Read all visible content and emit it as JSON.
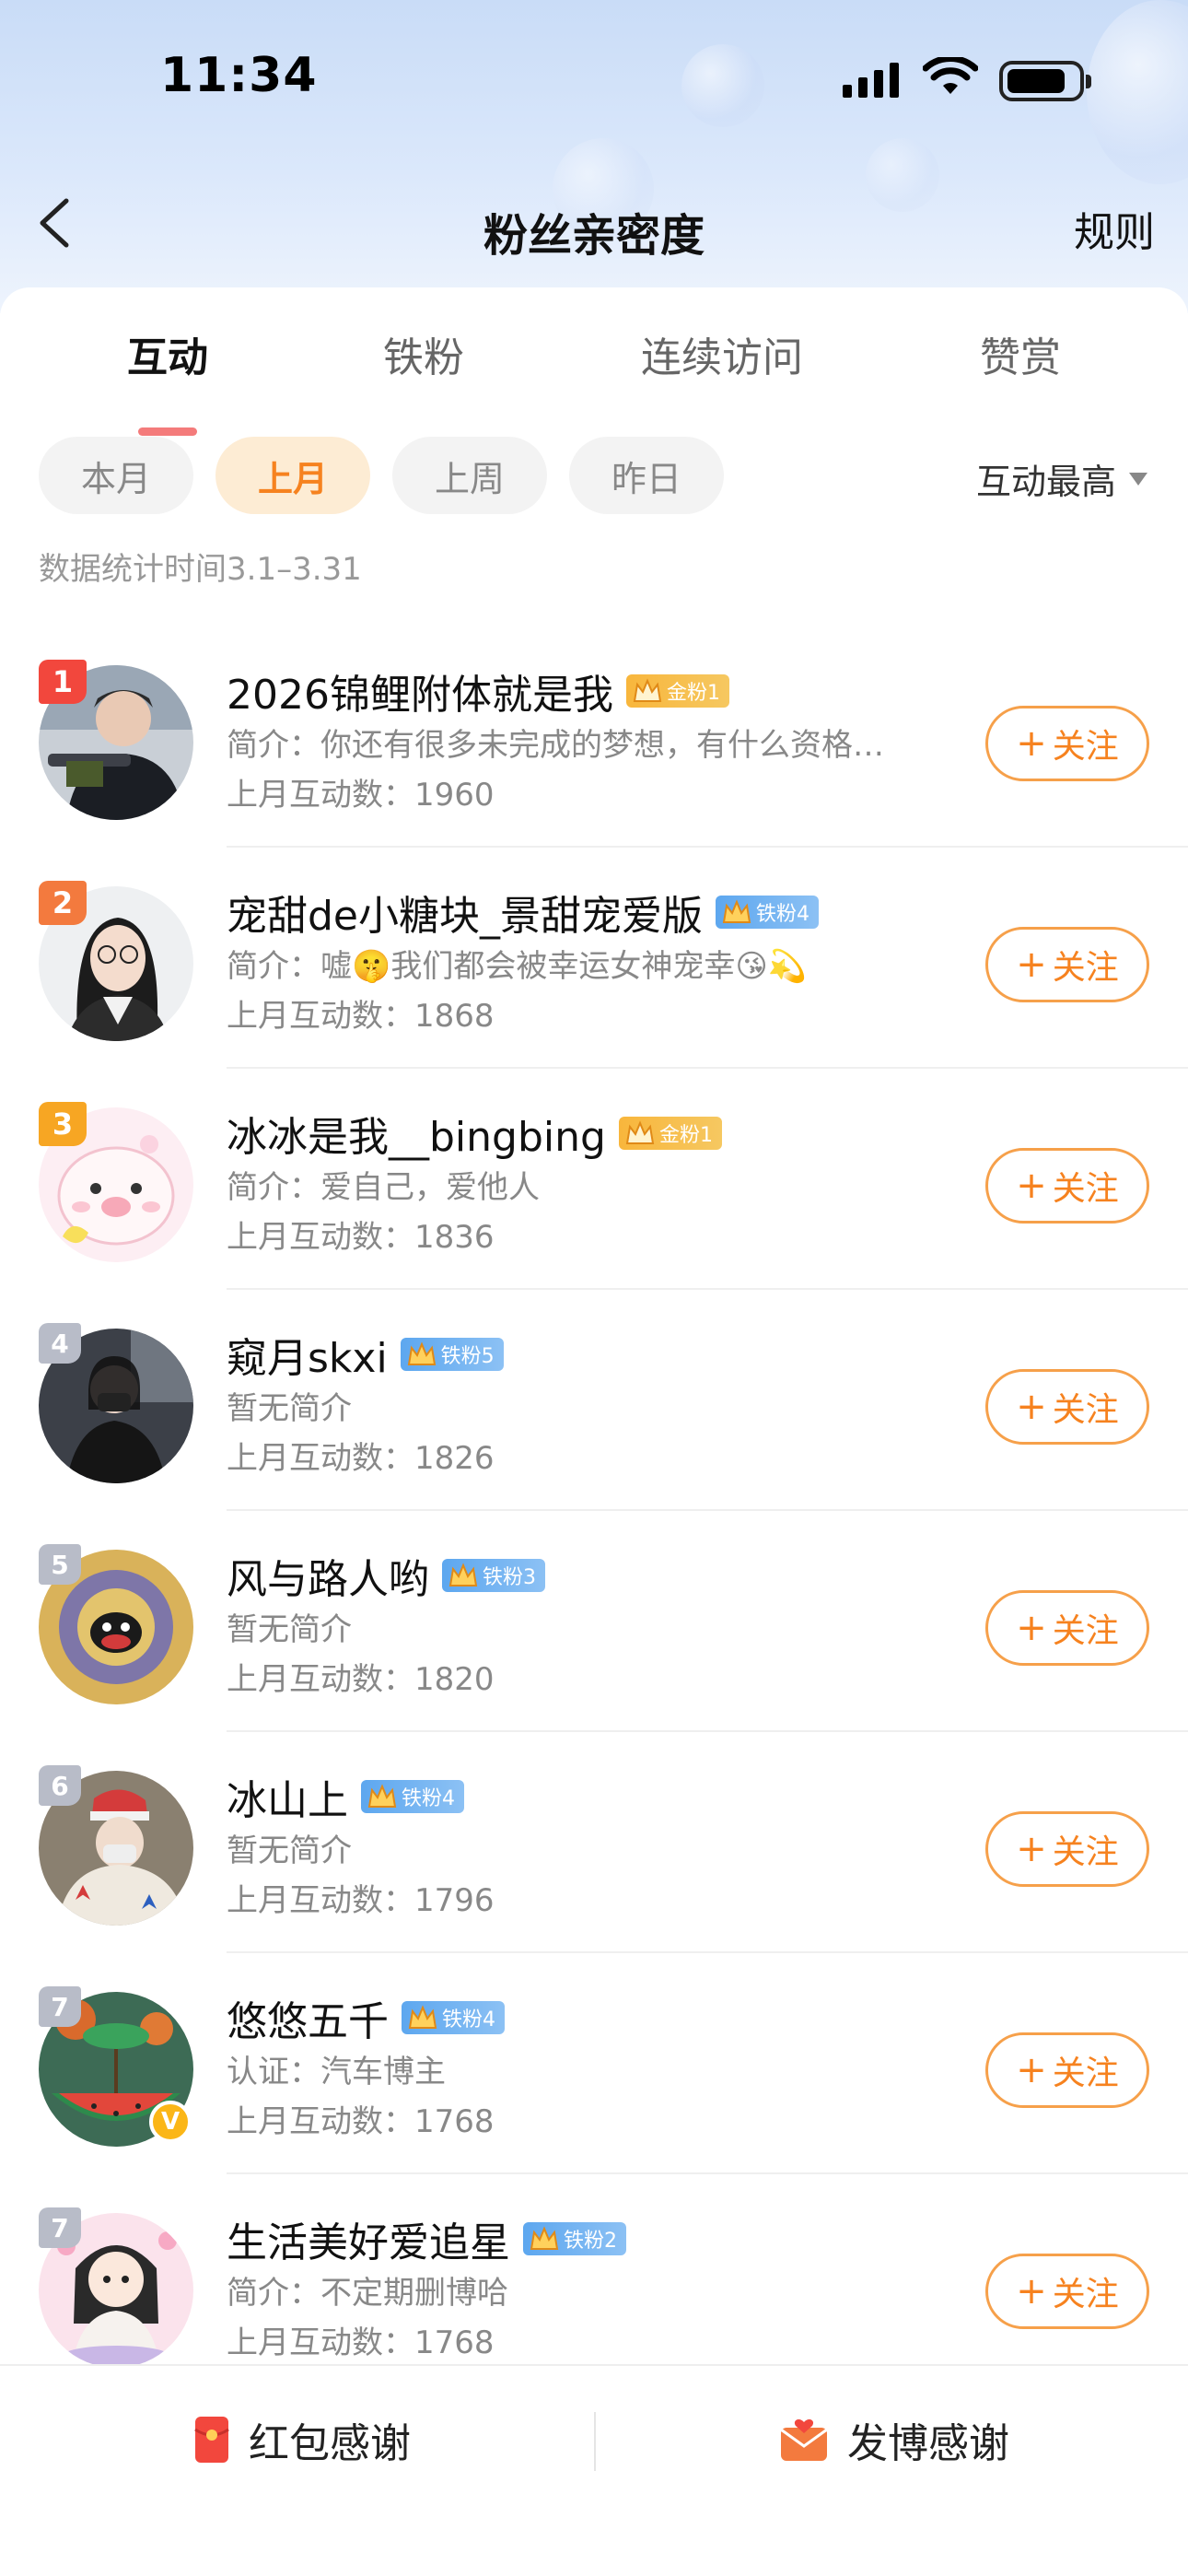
{
  "status_bar": {
    "time": "11:34"
  },
  "nav": {
    "title": "粉丝亲密度",
    "rules_label": "规则"
  },
  "tabs": [
    {
      "label": "互动",
      "active": true
    },
    {
      "label": "铁粉",
      "active": false
    },
    {
      "label": "连续访问",
      "active": false
    },
    {
      "label": "赞赏",
      "active": false
    }
  ],
  "filters": [
    {
      "label": "本月",
      "active": false
    },
    {
      "label": "上月",
      "active": true
    },
    {
      "label": "上周",
      "active": false
    },
    {
      "label": "昨日",
      "active": false
    }
  ],
  "sort": {
    "label": "互动最高"
  },
  "date_range": "数据统计时间3.1–3.31",
  "fans": [
    {
      "rank": "1",
      "name": "2026锦鲤附体就是我",
      "badge": "金粉1",
      "badge_type": "gold",
      "intro": "简介：你还有很多未完成的梦想，有什么资格…",
      "count": "上月互动数：1960",
      "follow": "关注"
    },
    {
      "rank": "2",
      "name": "宠甜de小糖块_景甜宠爱版",
      "badge": "铁粉4",
      "badge_type": "iron",
      "intro": "简介：嘘🤫我们都会被幸运女神宠幸😘💫",
      "count": "上月互动数：1868",
      "follow": "关注"
    },
    {
      "rank": "3",
      "name": "冰冰是我__bingbing",
      "badge": "金粉1",
      "badge_type": "gold",
      "intro": "简介：爱自己，爱他人",
      "count": "上月互动数：1836",
      "follow": "关注"
    },
    {
      "rank": "4",
      "name": "窥月skxi",
      "badge": "铁粉5",
      "badge_type": "iron",
      "intro": "暂无简介",
      "count": "上月互动数：1826",
      "follow": "关注"
    },
    {
      "rank": "5",
      "name": "风与路人哟",
      "badge": "铁粉3",
      "badge_type": "iron",
      "intro": "暂无简介",
      "count": "上月互动数：1820",
      "follow": "关注"
    },
    {
      "rank": "6",
      "name": "冰山上",
      "badge": "铁粉4",
      "badge_type": "iron",
      "intro": "暂无简介",
      "count": "上月互动数：1796",
      "follow": "关注"
    },
    {
      "rank": "7",
      "name": "悠悠五千",
      "badge": "铁粉4",
      "badge_type": "iron",
      "intro": "认证：汽车博主",
      "count": "上月互动数：1768",
      "follow": "关注",
      "verified": "V"
    },
    {
      "rank": "7",
      "name": "生活美好爱追星",
      "badge": "铁粉2",
      "badge_type": "iron",
      "intro": "简介：不定期删博哈",
      "count": "上月互动数：1768",
      "follow": "关注"
    }
  ],
  "bottom": {
    "left_label": "红包感谢",
    "right_label": "发博感谢"
  },
  "colors": {
    "accent": "#f6821f",
    "rank1": "#f2473d",
    "rank2": "#f37a3e",
    "rank3": "#f7a623",
    "gold_badge": "#f8b63c",
    "iron_badge": "#5da7ef"
  },
  "icons": [
    "back-icon",
    "signal-icon",
    "wifi-icon",
    "battery-icon",
    "caret-down-icon",
    "crown-icon",
    "red-envelope-icon",
    "post-thanks-icon"
  ]
}
